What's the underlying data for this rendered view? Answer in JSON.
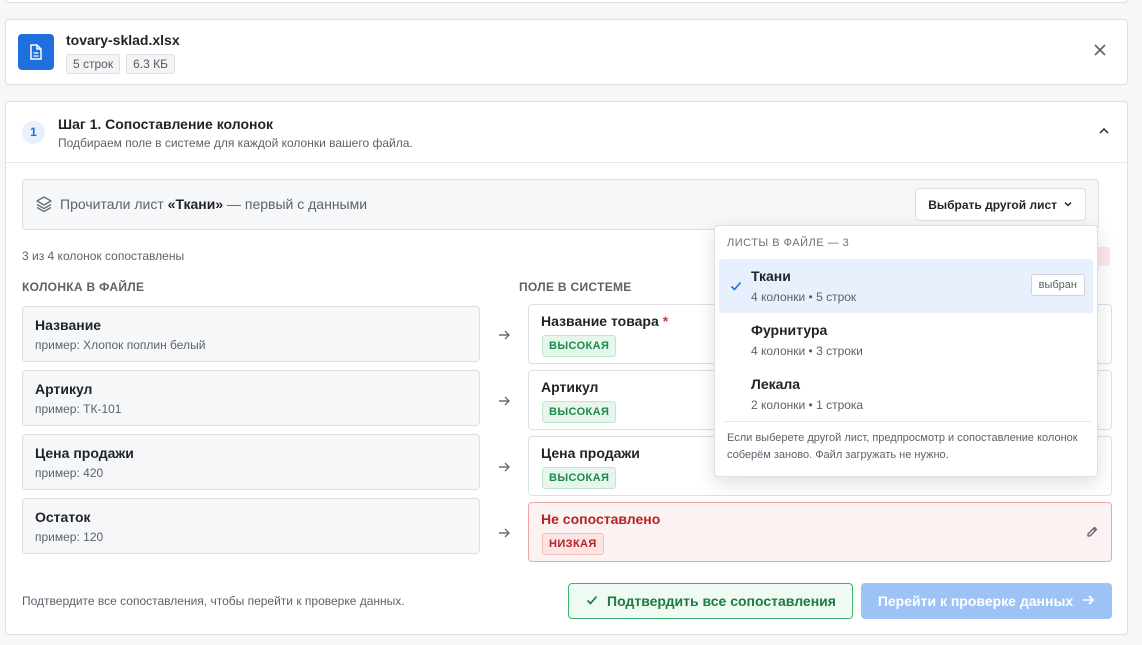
{
  "file": {
    "name": "tovary-sklad.xlsx",
    "rows": "5 строк",
    "size": "6.3 КБ"
  },
  "step": {
    "number": "1",
    "title": "Шаг 1. Сопоставление колонок",
    "subtitle": "Подбираем поле в системе для каждой колонки вашего файла."
  },
  "sheet": {
    "prefix": "Прочитали лист ",
    "name": "«Ткани»",
    "suffix": " — первый с данными",
    "button_label": "Выбрать другой лист"
  },
  "mapping": {
    "count_text": "3 из 4 колонок сопоставлены",
    "source_header": "КОЛОНКА В ФАЙЛЕ",
    "target_header": "ПОЛЕ В СИСТЕМЕ",
    "rows": [
      {
        "source": "Название",
        "example": "пример: Хлопок поплин белый",
        "target": "Название товара",
        "required": "*",
        "confidence": "ВЫСОКАЯ"
      },
      {
        "source": "Артикул",
        "example": "пример: ТК-101",
        "target": "Артикул",
        "confidence": "ВЫСОКАЯ"
      },
      {
        "source": "Цена продажи",
        "example": "пример: 420",
        "target": "Цена продажи",
        "confidence": "ВЫСОКАЯ"
      },
      {
        "source": "Остаток",
        "example": "пример: 120",
        "target": "Не сопоставлено",
        "confidence": "НИЗКАЯ"
      }
    ]
  },
  "footer": {
    "note": "Подтвердите все сопоставления, чтобы перейти к проверке данных.",
    "confirm_label": "Подтвердить все сопоставления",
    "next_label": "Перейти к проверке данных"
  },
  "dropdown": {
    "header": "ЛИСТЫ В ФАЙЛЕ — 3",
    "items": [
      {
        "name": "Ткани",
        "meta": "4 колонки • 5 строк",
        "tag": "выбран"
      },
      {
        "name": "Фурнитура",
        "meta": "4 колонки • 3 строки"
      },
      {
        "name": "Лекала",
        "meta": "2 колонки • 1 строка"
      }
    ],
    "note": "Если выберете другой лист, предпросмотр и сопоставление колонок соберём заново. Файл загружать не нужно."
  },
  "colors": {
    "accent": "#1f6fde",
    "success": "#1d8a4a",
    "danger": "#b42323"
  },
  "icons": [
    "document-icon",
    "close-icon",
    "chevron-up-icon",
    "layers-icon",
    "chevron-down-icon",
    "arrow-right-icon",
    "pencil-icon",
    "check-icon"
  ]
}
